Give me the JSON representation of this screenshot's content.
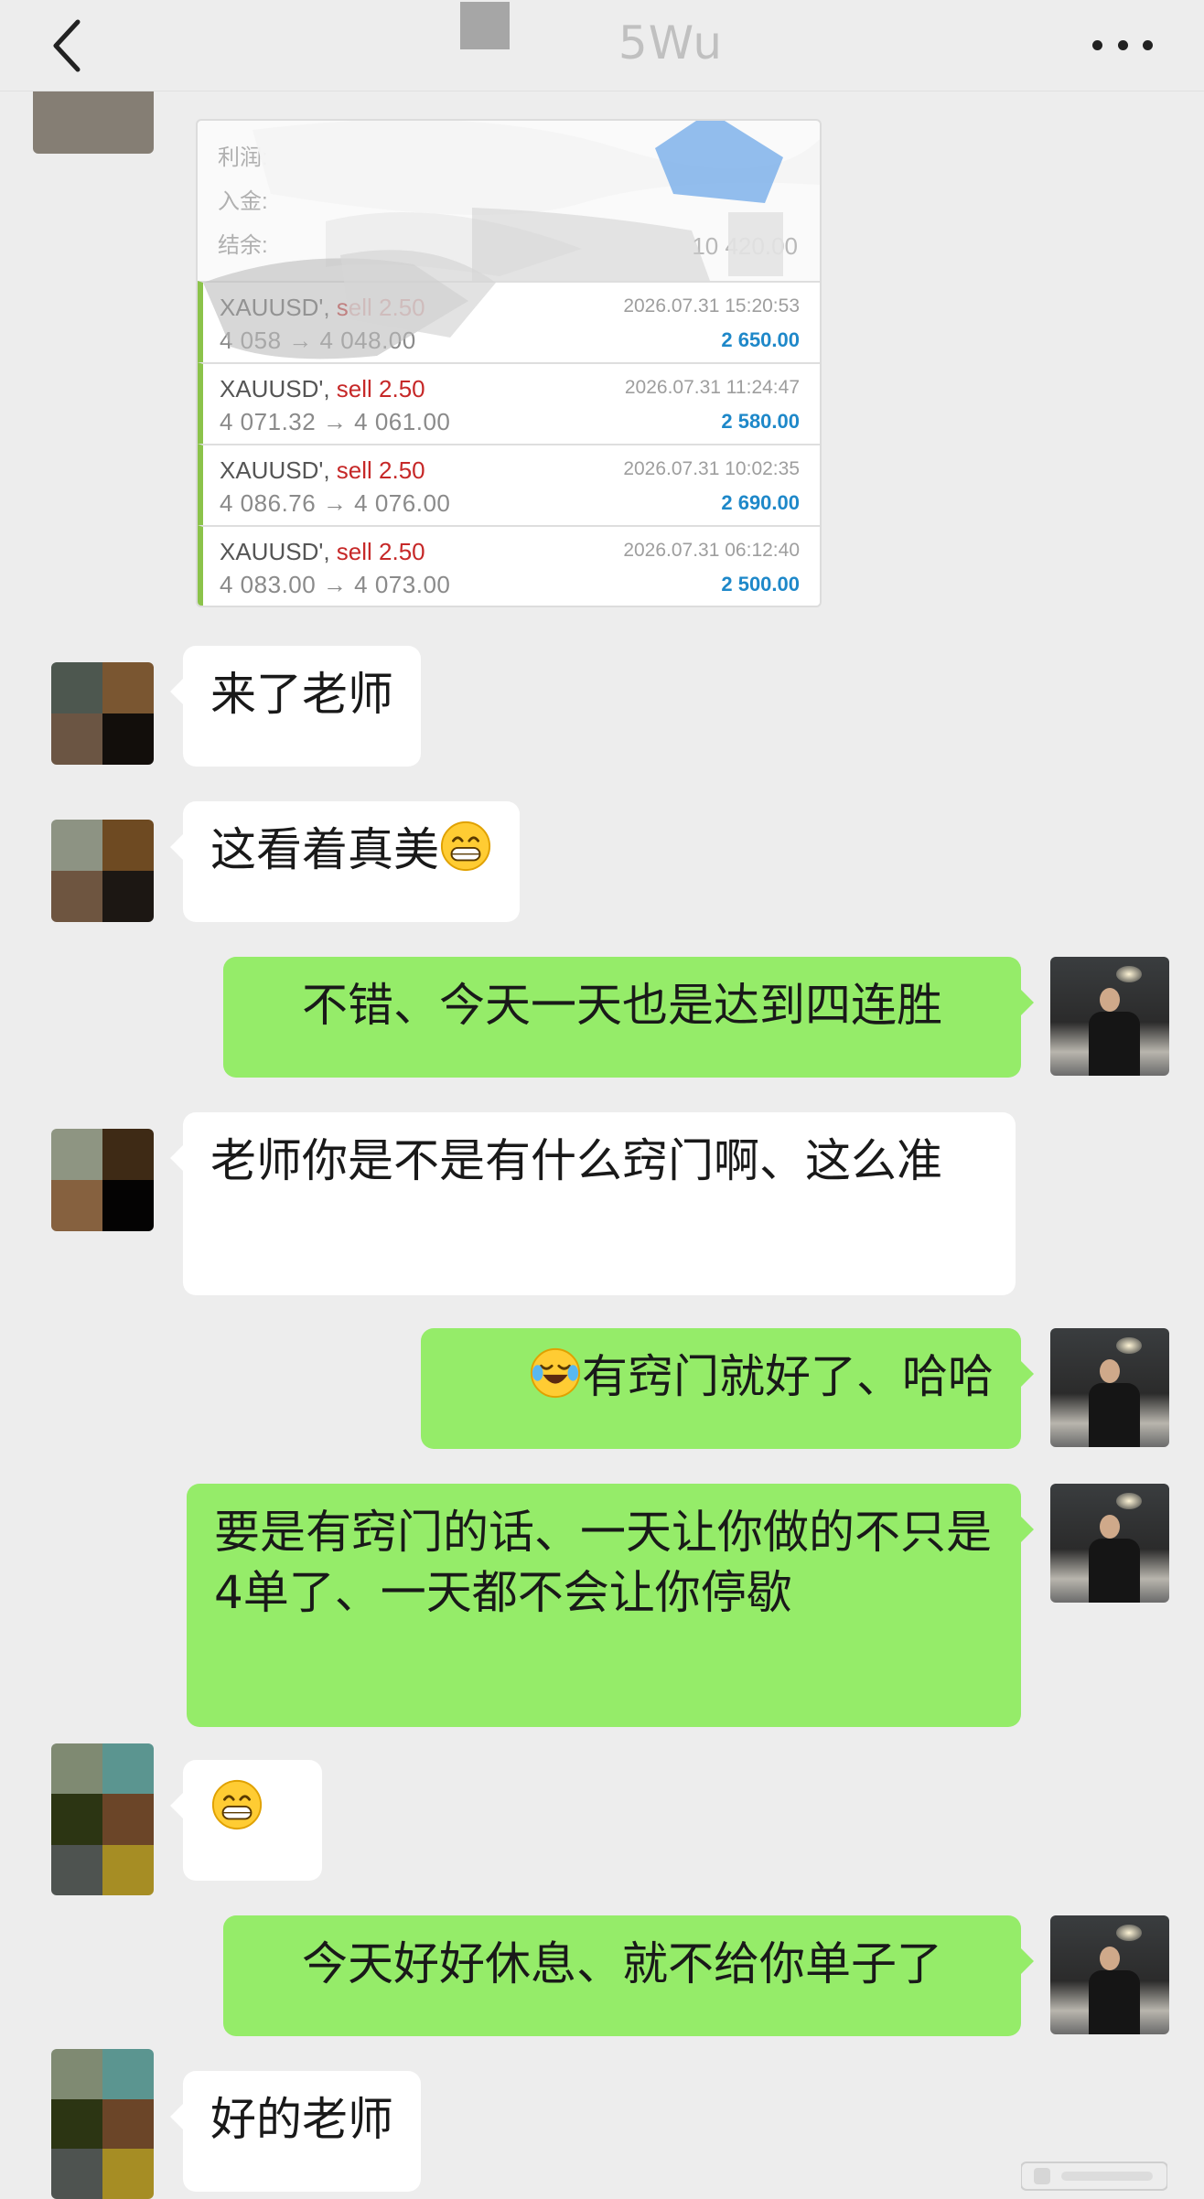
{
  "header": {
    "title": "5Wu",
    "back_icon": "chevron-left-icon",
    "more_icon": "more-dots-icon"
  },
  "screenshot": {
    "summary_labels": [
      "利润:",
      "入金:",
      "结余:"
    ],
    "summary_value": "10 420.00",
    "trades": [
      {
        "symbol": "XAUUSD',",
        "side": "sell 2.50",
        "price": "4 058 → 4 048.00",
        "time": "2026.07.31 15:20:53",
        "profit": "2 650.00"
      },
      {
        "symbol": "XAUUSD',",
        "side": "sell 2.50",
        "price": "4 071.32 → 4 061.00",
        "time": "2026.07.31 11:24:47",
        "profit": "2 580.00"
      },
      {
        "symbol": "XAUUSD',",
        "side": "sell 2.50",
        "price": "4 086.76 → 4 076.00",
        "time": "2026.07.31 10:02:35",
        "profit": "2 690.00"
      },
      {
        "symbol": "XAUUSD',",
        "side": "sell 2.50",
        "price": "4 083.00 → 4 073.00",
        "time": "2026.07.31 06:12:40",
        "profit": "2 500.00"
      }
    ]
  },
  "messages": [
    {
      "dir": "in",
      "text": "来了老师"
    },
    {
      "dir": "in",
      "text": "这看着真美",
      "emoji": "grin-emoji"
    },
    {
      "dir": "out",
      "text": "不错、今天一天也是达到四连胜"
    },
    {
      "dir": "in",
      "text": "老师你是不是有什么窍门啊、这么准"
    },
    {
      "dir": "out",
      "text": "有窍门就好了、哈哈",
      "emoji": "laugh-cry-emoji"
    },
    {
      "dir": "out",
      "text": "要是有窍门的话、一天让你做的不只是4单了、一天都不会让你停歇"
    },
    {
      "dir": "in",
      "text": "",
      "emoji": "grin-emoji"
    },
    {
      "dir": "out",
      "text": "今天好好休息、就不给你单子了"
    },
    {
      "dir": "in",
      "text": "好的老师"
    }
  ],
  "colors": {
    "background": "#ededed",
    "outgoing_bubble": "#95ec69",
    "incoming_bubble": "#ffffff",
    "profit_blue": "#1e88c9",
    "sell_red": "#c62828",
    "trade_accent": "#8bc34a"
  }
}
